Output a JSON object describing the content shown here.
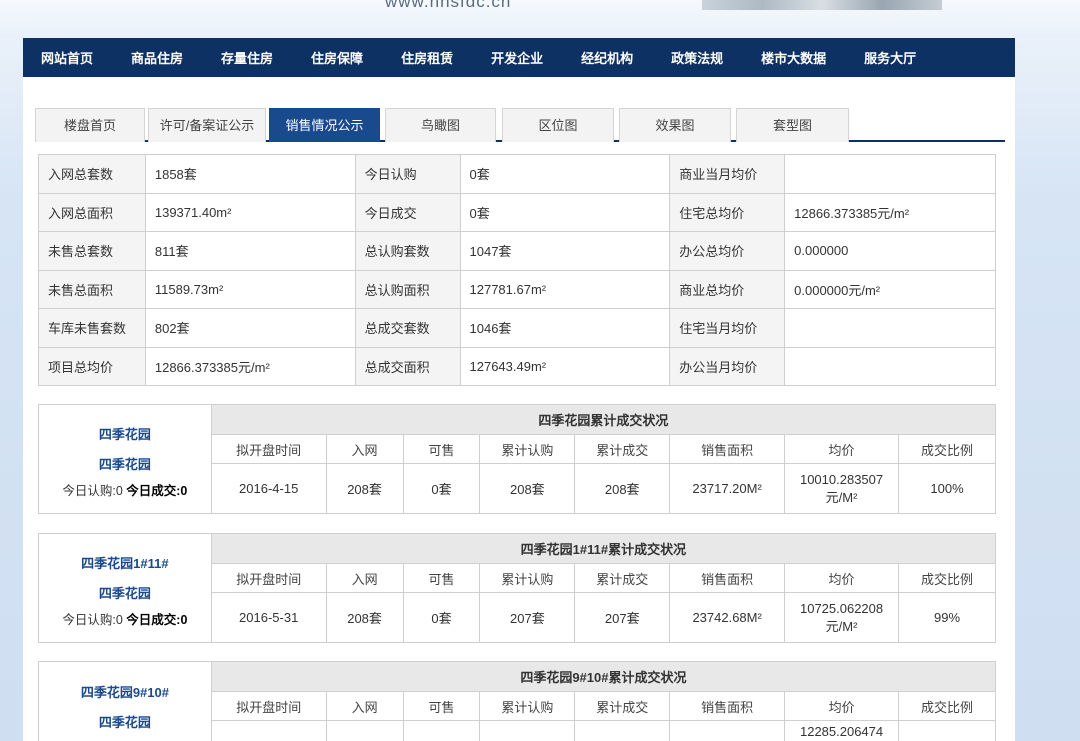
{
  "site": {
    "url": "www.nnsfdc.cn"
  },
  "nav": {
    "items": [
      "网站首页",
      "商品住房",
      "存量住房",
      "住房保障",
      "住房租赁",
      "开发企业",
      "经纪机构",
      "政策法规",
      "楼市大数据",
      "服务大厅"
    ]
  },
  "tabs": {
    "items": [
      "楼盘首页",
      "许可/备案证公示",
      "销售情况公示",
      "鸟瞰图",
      "区位图",
      "效果图",
      "套型图"
    ],
    "active": "销售情况公示"
  },
  "summary": {
    "rows": [
      [
        "入网总套数",
        "1858套",
        "今日认购",
        "0套",
        "商业当月均价",
        ""
      ],
      [
        "入网总面积",
        "139371.40m²",
        "今日成交",
        "0套",
        "住宅总均价",
        "12866.373385元/m²"
      ],
      [
        "未售总套数",
        "811套",
        "总认购套数",
        "1047套",
        "办公总均价",
        "0.000000"
      ],
      [
        "未售总面积",
        "11589.73m²",
        "总认购面积",
        "127781.67m²",
        "商业总均价",
        "0.000000元/m²"
      ],
      [
        "车库未售套数",
        "802套",
        "总成交套数",
        "1046套",
        "住宅当月均价",
        ""
      ],
      [
        "项目总均价",
        "12866.373385元/m²",
        "总成交面积",
        "127643.49m²",
        "办公当月均价",
        ""
      ]
    ]
  },
  "blocks": {
    "headers": [
      "拟开盘时间",
      "入网",
      "可售",
      "累计认购",
      "累计成交",
      "销售面积",
      "均价",
      "成交比例"
    ],
    "items": [
      {
        "name": "四季花园",
        "sub": "四季花园",
        "today_sub": "今日认购:0",
        "today_deal": "今日成交:0",
        "title": "四季花园累计成交状况",
        "open_date": "2016-4-15",
        "in_net": "208套",
        "for_sale": "0套",
        "subscribed": "208套",
        "dealt": "208套",
        "area": "23717.20M²",
        "avg_price_1": "10010.283507",
        "avg_price_2": "元/M²",
        "ratio": "100%"
      },
      {
        "name": "四季花园1#11#",
        "sub": "四季花园",
        "today_sub": "今日认购:0",
        "today_deal": "今日成交:0",
        "title": "四季花园1#11#累计成交状况",
        "open_date": "2016-5-31",
        "in_net": "208套",
        "for_sale": "0套",
        "subscribed": "207套",
        "dealt": "207套",
        "area": "23742.68M²",
        "avg_price_1": "10725.062208",
        "avg_price_2": "元/M²",
        "ratio": "99%"
      },
      {
        "name": "四季花园9#10#",
        "sub": "四季花园",
        "title": "四季花园9#10#累计成交状况",
        "avg_price_1": "12285.206474"
      }
    ]
  }
}
